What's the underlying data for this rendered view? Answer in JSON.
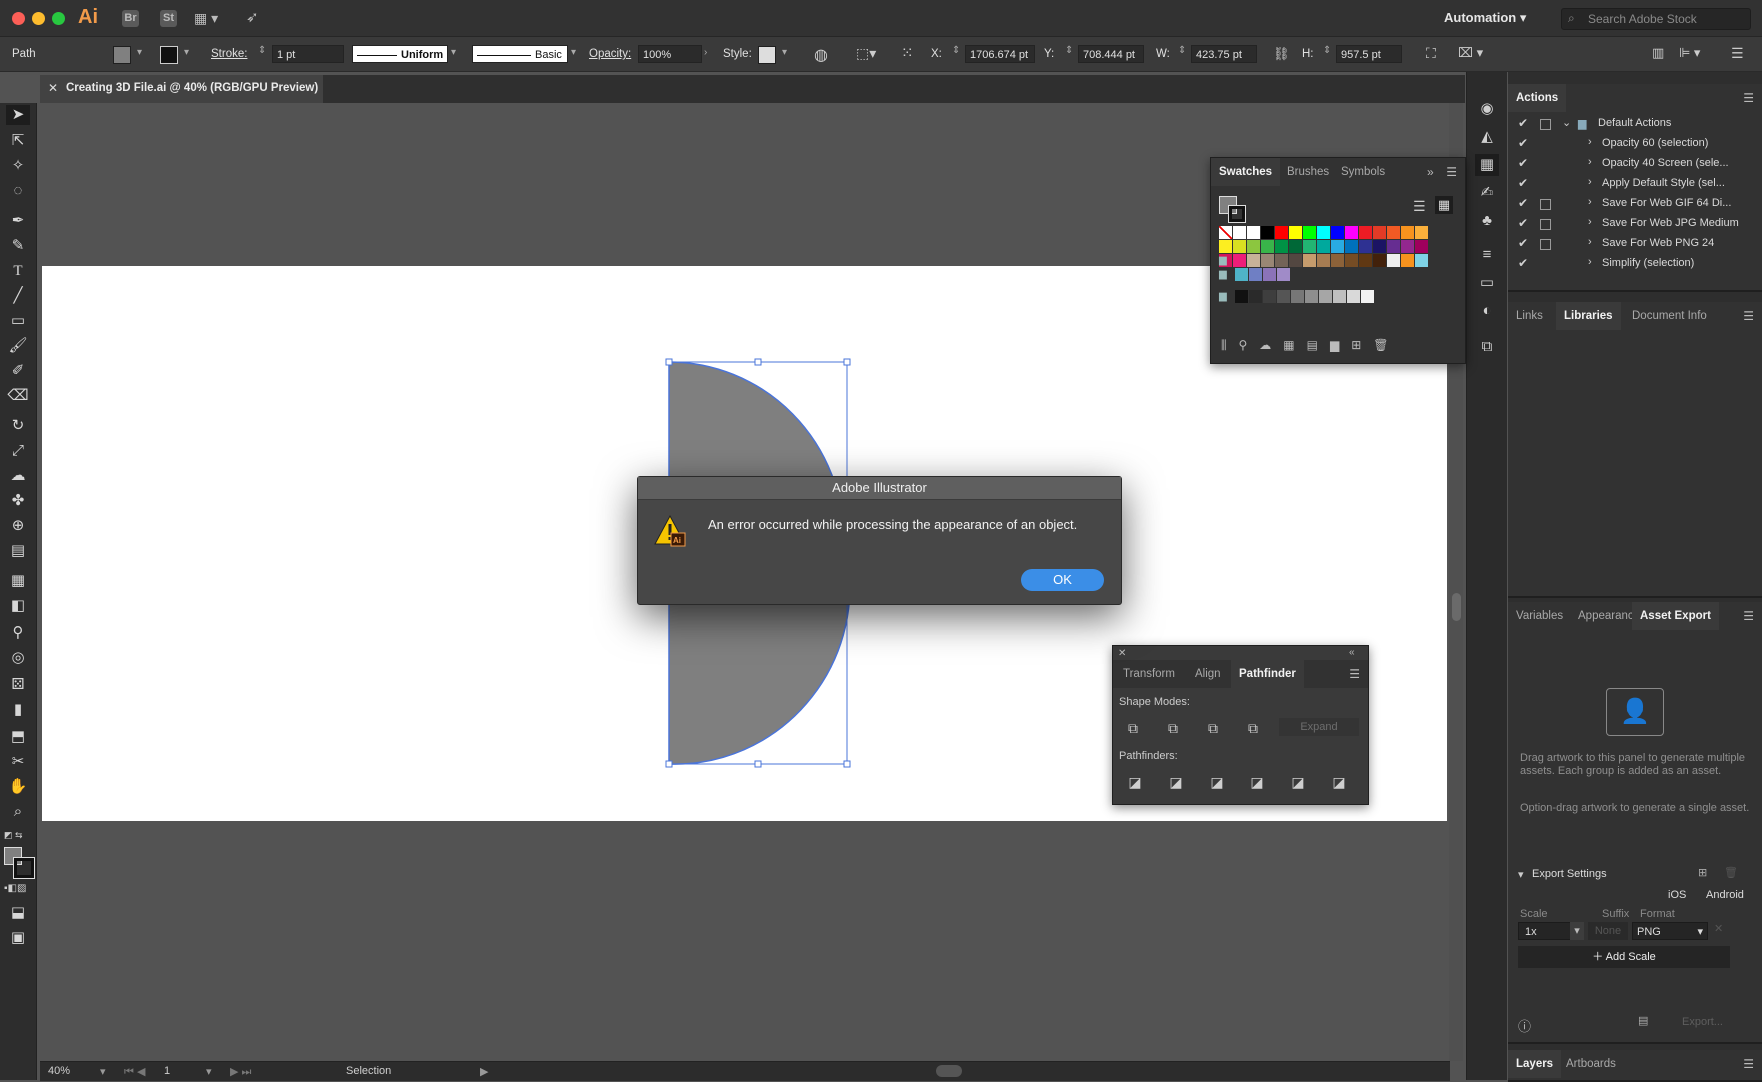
{
  "app": {
    "logo": "Ai",
    "bridge_label": "Br",
    "stock_label": "St",
    "workspace": "Automation",
    "search_placeholder": "Search Adobe Stock"
  },
  "control_bar": {
    "object_type": "Path",
    "stroke_label": "Stroke:",
    "stroke_weight": "1 pt",
    "stroke_profile": "Uniform",
    "brush": "Basic",
    "opacity_label": "Opacity:",
    "opacity_value": "100%",
    "style_label": "Style:",
    "x_label": "X:",
    "x_value": "1706.674 pt",
    "y_label": "Y:",
    "y_value": "708.444 pt",
    "w_label": "W:",
    "w_value": "423.75 pt",
    "h_label": "H:",
    "h_value": "957.5 pt"
  },
  "document": {
    "tab_title": "Creating 3D File.ai @ 40% (RGB/GPU Preview)"
  },
  "status_bar": {
    "zoom": "40%",
    "artboard_number": "1",
    "tool": "Selection"
  },
  "dialog": {
    "title": "Adobe Illustrator",
    "message": "An error occurred while processing the appearance of an object.",
    "ok_label": "OK"
  },
  "swatches_panel": {
    "tabs": [
      "Swatches",
      "Brushes",
      "Symbols"
    ]
  },
  "pathfinder_panel": {
    "tabs": [
      "Transform",
      "Align",
      "Pathfinder"
    ],
    "shape_modes_label": "Shape Modes:",
    "expand_label": "Expand",
    "pathfinders_label": "Pathfinders:"
  },
  "actions_panel": {
    "title": "Actions",
    "set_name": "Default Actions",
    "items": [
      "Opacity 60 (selection)",
      "Opacity 40 Screen (sele...",
      "Apply Default Style (sel...",
      "Save For Web GIF 64 Di...",
      "Save For Web JPG Medium",
      "Save For Web PNG 24",
      "Simplify (selection)"
    ]
  },
  "libraries_panel": {
    "tabs": [
      "Links",
      "Libraries",
      "Document Info"
    ]
  },
  "asset_export_panel": {
    "tabs": [
      "Variables",
      "Appearanc",
      "Asset Export"
    ],
    "hint1": "Drag artwork to this panel to generate multiple assets. Each group is added as an asset.",
    "hint2": "Option-drag artwork to generate a single asset.",
    "export_settings": "Export Settings",
    "ios": "iOS",
    "android": "Android",
    "scale_label": "Scale",
    "suffix_label": "Suffix",
    "format_label": "Format",
    "scale_value": "1x",
    "suffix_placeholder": "None",
    "format_value": "PNG",
    "add_scale": "Add Scale",
    "export_button": "Export..."
  },
  "layers_panel": {
    "tabs": [
      "Layers",
      "Artboards"
    ]
  },
  "colors": {
    "shape_fill": "#7f7f7f",
    "selection": "#4a74d9",
    "ok_button": "#3b8ee7"
  }
}
